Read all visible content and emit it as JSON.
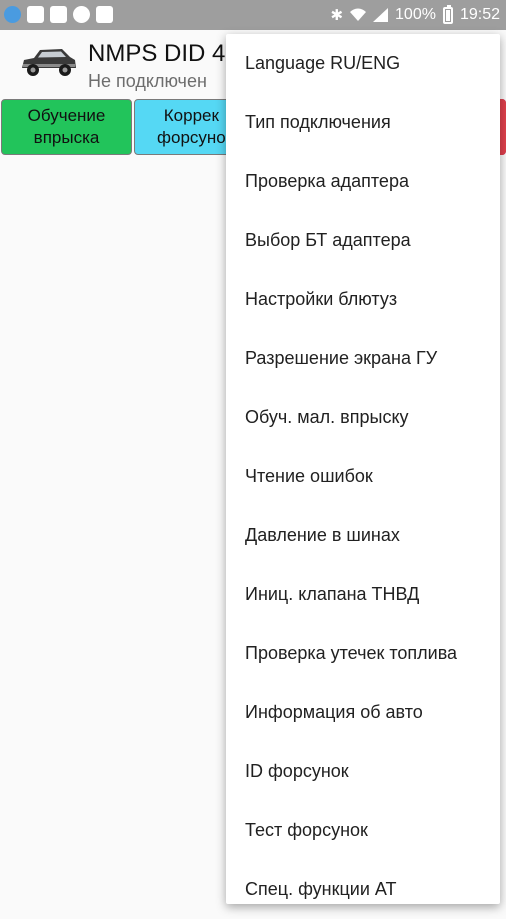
{
  "status_bar": {
    "battery": "100%",
    "time": "19:52"
  },
  "app": {
    "title": "NMPS DID 4",
    "subtitle": "Не подключен"
  },
  "tabs": [
    {
      "label": "Обучение\nвпрыска"
    },
    {
      "label": "Коррек\nфорсуно"
    }
  ],
  "menu": {
    "items": [
      "Language RU/ENG",
      "Тип подключения",
      "Проверка адаптера",
      "Выбор БТ адаптера",
      "Настройки блютуз",
      "Разрешение экрана ГУ",
      "Обуч. мал. впрыску",
      "Чтение ошибок",
      "Давление в шинах",
      "Иниц. клапана ТНВД",
      "Проверка утечек топлива",
      "Информация об авто",
      "ID форсунок",
      "Тест форсунок",
      "Спец. функции АТ"
    ]
  },
  "colors": {
    "tab_green": "#22c45b",
    "tab_cyan": "#55d8f4",
    "status_bar": "#9e9e9e"
  }
}
